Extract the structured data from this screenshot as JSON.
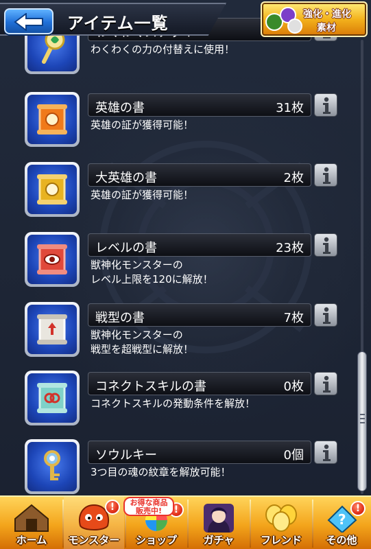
{
  "header": {
    "title": "アイテム一覧",
    "material_button": {
      "label_line1_a": "強化",
      "label_line1_sep": "・",
      "label_line1_b": "進化",
      "label_line2": "素材"
    }
  },
  "items": [
    {
      "name": "わくわくステッキ",
      "count": "",
      "desc_lines": [
        "わくわくの力の付替えに使用！"
      ],
      "icon": "wand-icon",
      "scroll_color": "#2ea44f"
    },
    {
      "name": "英雄の書",
      "count": "31枚",
      "desc_lines": [
        "英雄の証が獲得可能！"
      ],
      "icon": "hero-scroll-icon",
      "scroll_color": "#f07a1a"
    },
    {
      "name": "大英雄の書",
      "count": "2枚",
      "desc_lines": [
        "英雄の証が獲得可能！"
      ],
      "icon": "great-hero-scroll-icon",
      "scroll_color": "#e8b321"
    },
    {
      "name": "レベルの書",
      "count": "23枚",
      "desc_lines": [
        "獣神化モンスターの",
        "レベル上限を120に解放！"
      ],
      "icon": "level-scroll-icon",
      "scroll_color": "#e0493b"
    },
    {
      "name": "戦型の書",
      "count": "7枚",
      "desc_lines": [
        "獣神化モンスターの",
        "戦型を超戦型に解放！"
      ],
      "icon": "battle-type-scroll-icon",
      "scroll_color": "#e9e6df"
    },
    {
      "name": "コネクトスキルの書",
      "count": "0枚",
      "desc_lines": [
        "コネクトスキルの発動条件を解放！"
      ],
      "icon": "connect-skill-scroll-icon",
      "scroll_color": "#7fd1c8"
    },
    {
      "name": "ソウルキー",
      "count": "0個",
      "desc_lines": [
        "3つ目の魂の紋章を解放可能！"
      ],
      "icon": "soul-key-icon",
      "scroll_color": "#8ec6ee"
    }
  ],
  "bottom_nav": {
    "home": "ホーム",
    "monster": "モンスター",
    "shop": "ショップ",
    "gacha": "ガチャ",
    "friend": "フレンド",
    "other": "その他",
    "deal_bubble_line1": "お得な商品",
    "deal_bubble_line2": "販売中!",
    "badge": "!"
  },
  "colors": {
    "background": "#1b2231",
    "nav_gold": "#f3a41b",
    "back_blue": "#1f6fd8",
    "badge_red": "#e3321b"
  }
}
